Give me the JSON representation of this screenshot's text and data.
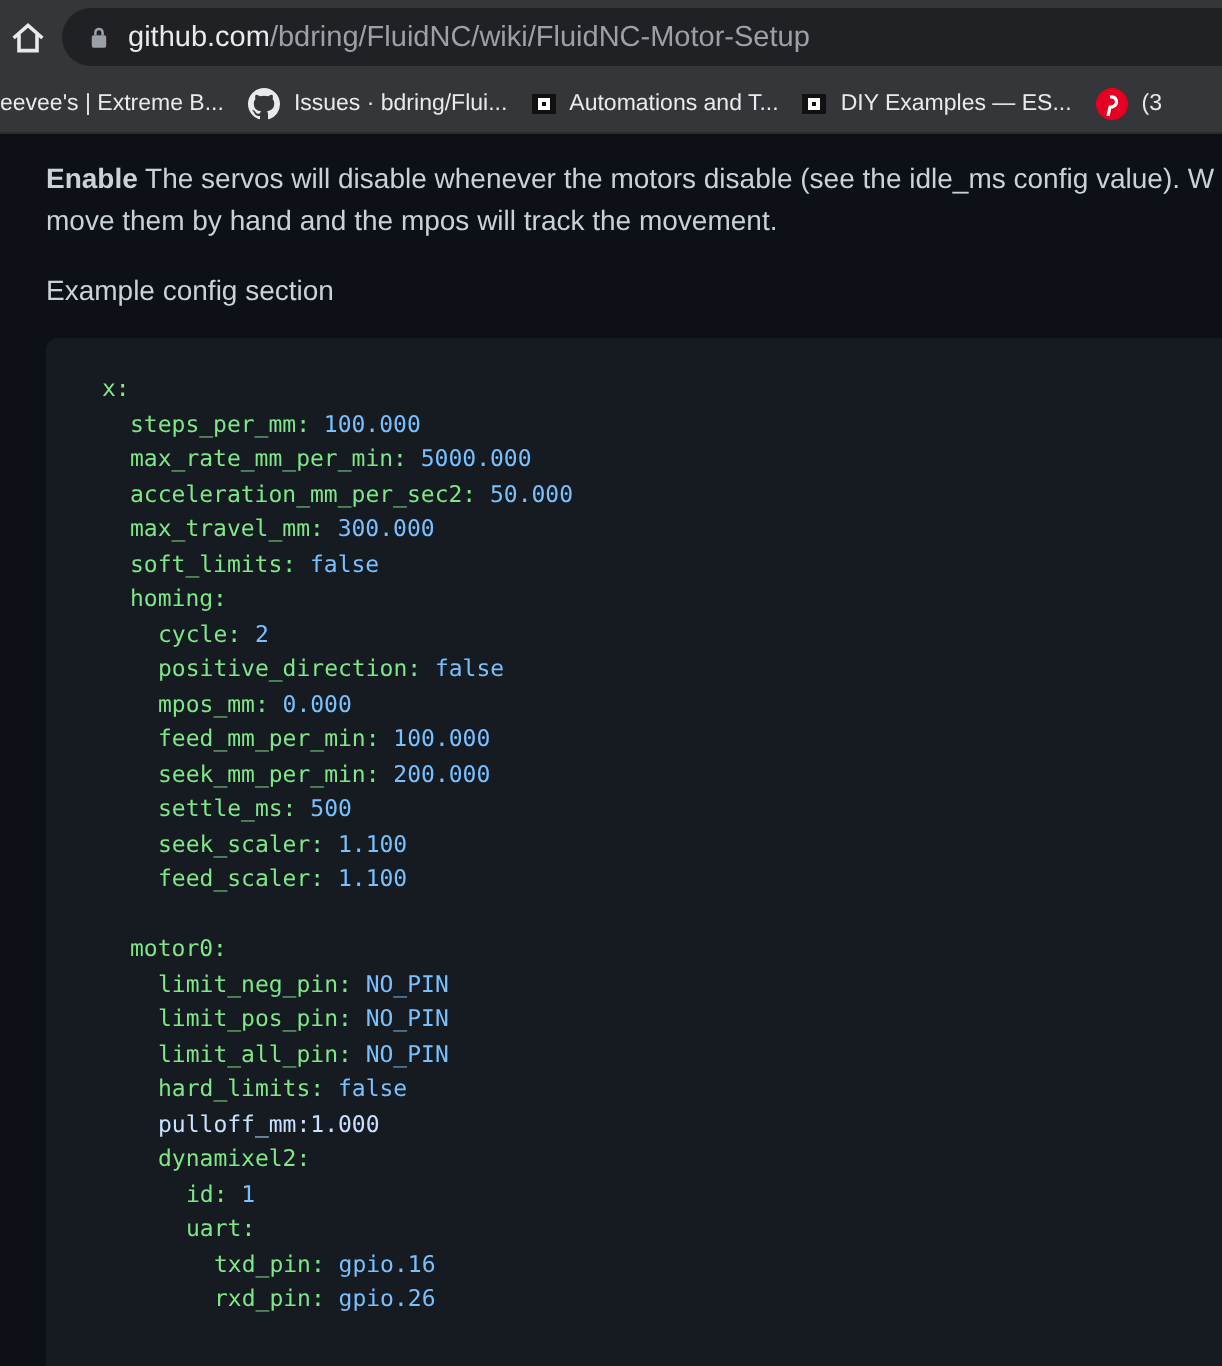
{
  "browser": {
    "url_host": "github.com",
    "url_path": "/bdring/FluidNC/wiki/FluidNC-Motor-Setup"
  },
  "bookmarks": [
    {
      "kind": "none",
      "label": "eevee's | Extreme B..."
    },
    {
      "kind": "github",
      "label": "Issues · bdring/Flui..."
    },
    {
      "kind": "square",
      "label": "Automations and T..."
    },
    {
      "kind": "square",
      "label": "DIY Examples — ES..."
    },
    {
      "kind": "pinterest",
      "label": "(3"
    }
  ],
  "paragraph_lines": [
    "**Enable** The servos will disable whenever the motors disable (see the idle_ms config value). W",
    "move them by hand and the mpos will track the movement."
  ],
  "caption": "Example config section",
  "code": [
    {
      "key": "x:",
      "children": [
        {
          "key": "steps_per_mm:",
          "value": "100.000"
        },
        {
          "key": "max_rate_mm_per_min:",
          "value": "5000.000"
        },
        {
          "key": "acceleration_mm_per_sec2:",
          "value": "50.000"
        },
        {
          "key": "max_travel_mm:",
          "value": "300.000"
        },
        {
          "key": "soft_limits:",
          "value": "false"
        },
        {
          "key": "homing:",
          "children": [
            {
              "key": "cycle:",
              "value": "2"
            },
            {
              "key": "positive_direction:",
              "value": "false"
            },
            {
              "key": "mpos_mm:",
              "value": "0.000"
            },
            {
              "key": "feed_mm_per_min:",
              "value": "100.000"
            },
            {
              "key": "seek_mm_per_min:",
              "value": "200.000"
            },
            {
              "key": "settle_ms:",
              "value": "500"
            },
            {
              "key": "seek_scaler:",
              "value": "1.100"
            },
            {
              "key": "feed_scaler:",
              "value": "1.100"
            }
          ]
        },
        {
          "key": "motor0:",
          "gap_before": true,
          "children": [
            {
              "key": "limit_neg_pin:",
              "value": "NO_PIN"
            },
            {
              "key": "limit_pos_pin:",
              "value": "NO_PIN"
            },
            {
              "key": "limit_all_pin:",
              "value": "NO_PIN"
            },
            {
              "key": "hard_limits:",
              "value": "false"
            },
            {
              "key": "pulloff_mm:1.000",
              "kind": "plain"
            },
            {
              "key": "dynamixel2:",
              "children": [
                {
                  "key": "id:",
                  "value": "1"
                },
                {
                  "key": "uart:",
                  "children": [
                    {
                      "key": "txd_pin:",
                      "value": "gpio.16"
                    },
                    {
                      "key": "rxd_pin:",
                      "value": "gpio.26"
                    }
                  ]
                }
              ]
            }
          ]
        }
      ]
    }
  ]
}
